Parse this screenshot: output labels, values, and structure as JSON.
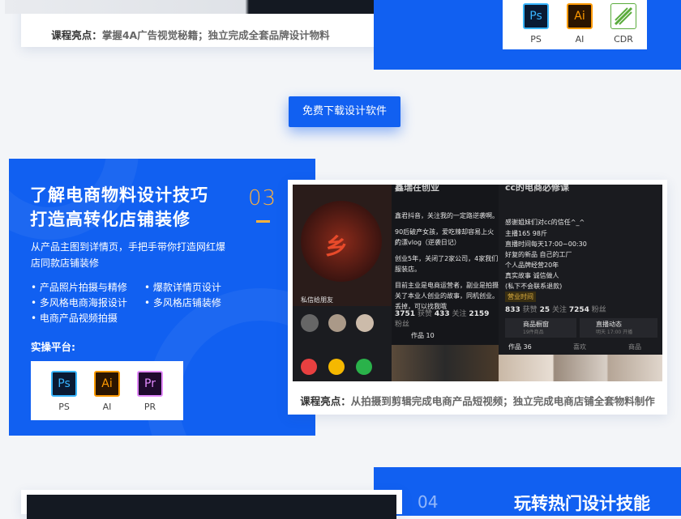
{
  "top_section": {
    "highlight_label": "课程亮点：",
    "highlight_text": "掌握4A广告视觉秘籍；独立完成全套品牌设计物料",
    "software": [
      {
        "icon": "ps-icon",
        "glyph": "Ps",
        "label": "PS"
      },
      {
        "icon": "ai-icon",
        "glyph": "Ai",
        "label": "AI"
      },
      {
        "icon": "cdr-icon",
        "glyph": "",
        "label": "CDR"
      }
    ]
  },
  "download_button": "免费下载设计软件",
  "section3": {
    "title_line1": "了解电商物料设计技巧",
    "title_line2": "打造高转化店铺装修",
    "number": "03",
    "desc": "从产品主图到详情页，手把手带你打造网红爆店同款店铺装修",
    "bullets_left": [
      "产品照片拍摄与精修",
      "多风格电商海报设计",
      "电商产品视频拍摄"
    ],
    "bullets_right": [
      "爆款详情页设计",
      "多风格店铺装修"
    ],
    "practice_label": "实操平台:",
    "software": [
      {
        "icon": "ps-icon",
        "glyph": "Ps",
        "label": "PS"
      },
      {
        "icon": "ai-icon",
        "glyph": "Ai",
        "label": "AI"
      },
      {
        "icon": "pr-icon",
        "glyph": "Pr",
        "label": "PR"
      }
    ],
    "highlight_label": "课程亮点：",
    "highlight_text": "从拍摄到剪辑完成电商产品短视频；独立完成电商店铺全套物料制作",
    "screenshot": {
      "left_caption": "私信给朋友",
      "profile1_title": "鑫瑞在创业",
      "profile1_lines": [
        "鑫君抖音，关注我的一定路逆袭啊。",
        "90后破产女孩，爱吃辣却容易上火的",
        "广漂vlog（逆袭日记）",
        "创业5年，关闭了2家公司，4家我们",
        "服装店。",
        "目前主业是电商运营者，副业是拍摄",
        "关了本业人创业的故事，同机创业。",
        "丢掉，可以找我哦"
      ],
      "profile1_stats": [
        "3751",
        "获赞",
        "433",
        "关注",
        "2159",
        "粉丝"
      ],
      "profile1_tab": "作品 10",
      "profile2_title": "cc的电商必修课",
      "profile2_lines": [
        "感谢姐妹们对cc的信任^_^",
        "主播165 98斤",
        "直播时间每天17:00~00:30",
        "好复的新品 自己的工厂",
        "个人品牌经营20年",
        "真实故事 诚信做人",
        "(私下不会联系退款)"
      ],
      "profile2_badge": "营业时间",
      "profile2_stats": [
        "833",
        "获赞",
        "25",
        "关注",
        "7254",
        "粉丝"
      ],
      "profile2_shop": "商品橱窗",
      "profile2_shop_sub": "19件商品",
      "profile2_live": "直播动态",
      "profile2_live_sub": "明天 17:00 开播",
      "profile2_tabs": [
        "作品 36",
        "喜欢",
        "商品"
      ]
    }
  },
  "section4": {
    "number": "04",
    "title": "玩转热门设计技能"
  }
}
